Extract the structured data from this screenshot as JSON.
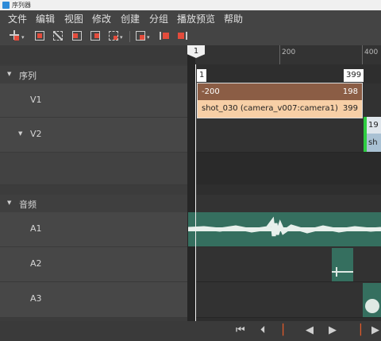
{
  "window": {
    "title": "序列器"
  },
  "menu": [
    "文件",
    "编辑",
    "视图",
    "修改",
    "创建",
    "分组",
    "播放预览",
    "帮助"
  ],
  "toolbar": {
    "icons": [
      "add-track-icon",
      "fit-icon",
      "ripple-delete-icon",
      "cut-left-icon",
      "cut-right-icon",
      "clear-icon",
      "group-icon",
      "mark-in-icon",
      "mark-out-icon"
    ]
  },
  "ruler": {
    "ticks": [
      "200",
      "400"
    ],
    "current_frame": "1"
  },
  "sections": {
    "sequence": "序列",
    "audio": "音频"
  },
  "tracks": {
    "v1": "V1",
    "v2": "V2",
    "a1": "A1",
    "a2": "A2",
    "a3": "A3"
  },
  "range": {
    "start": "1",
    "end": "399"
  },
  "clip": {
    "offset_left": "-200",
    "offset_right": "198",
    "name": "shot_030 (camera_v007:camera1)",
    "end_frame": "399"
  },
  "v2_clip": {
    "label_top": "19",
    "label_bottom": "sh"
  },
  "colors": {
    "accent_in": "#2ecc40",
    "clip_head": "#8b5d45",
    "clip_body": "#f7cfa6",
    "audio_bg": "#356f5f",
    "playhead_marker": "#e05a2a"
  },
  "transport": [
    "jump-start-icon",
    "prev-frame-icon",
    "mark-in-icon",
    "play-reverse-icon",
    "play-icon",
    "mark-out-icon",
    "next-frame-icon"
  ]
}
